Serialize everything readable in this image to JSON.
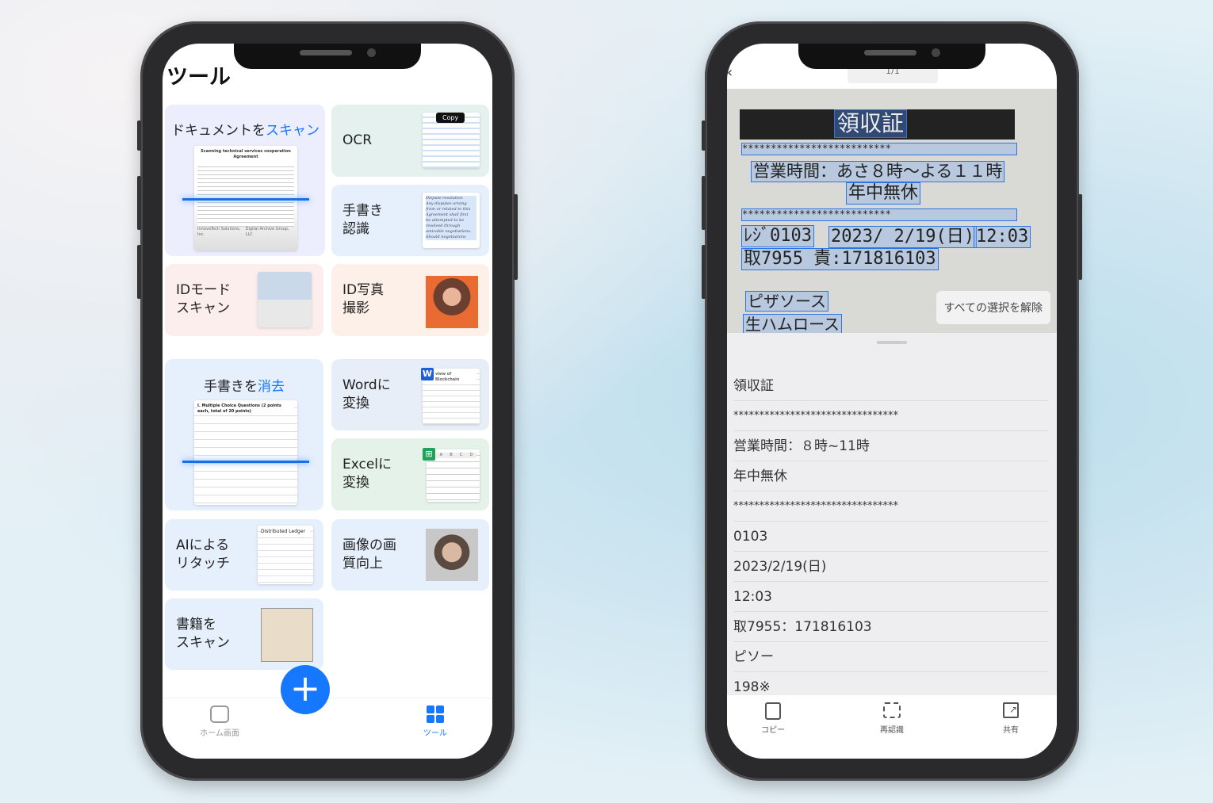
{
  "left_phone": {
    "title": "ツール",
    "cards": [
      {
        "label_main": "ドキュメントを",
        "label_accent": "スキャン",
        "thumb_title": "Scanning technical services cooperation Agreement",
        "thumb_footer_left": "InnovaTech Solutions, Inc.",
        "thumb_footer_right": "Digital Archive Group, LLC"
      },
      {
        "label": "OCR",
        "tooltip": "Copy"
      },
      {
        "label": "手書き\n認識",
        "thumb_lines": [
          "Dispute resolution",
          "Any disputes arising",
          "from or related to this",
          "Agreement shall first",
          "be attempted to be",
          "resolved through",
          "amicable negotiations.",
          "Should negotiations"
        ]
      },
      {
        "label": "IDモード\nスキャン"
      },
      {
        "label": "ID写真\n撮影"
      },
      {
        "label_main": "手書きを",
        "label_accent": "消去",
        "thumb_title": "I. Multiple Choice Questions (2 points each, total of 20 points)"
      },
      {
        "label": "Wordに\n変換",
        "thumb_title": "view of Blockchain",
        "icon_letter": "W"
      },
      {
        "label": "Excelに\n変換",
        "col_headers": [
          "A",
          "B",
          "C",
          "D"
        ]
      },
      {
        "label": "AIによる\nリタッチ",
        "thumb_title": "Distributed Ledger"
      },
      {
        "label": "画像の画\n質向上"
      },
      {
        "label": "書籍を\nスキャン"
      }
    ],
    "nav": {
      "home": "ホーム画面",
      "tools": "ツール",
      "add_icon": "plus-icon"
    },
    "accent": "#1677ff"
  },
  "right_phone": {
    "page_indicator": "1/1",
    "receipt": {
      "header": "領収証",
      "stars": "**************************",
      "hours": "営業時間：あさ８時～よる１１時",
      "holiday": "年中無休",
      "register": "ﾚｼﾞ0103",
      "date": "2023/ 2/19(日)",
      "time": "12:03",
      "transaction": "取7955 責:171816103",
      "item1": "ピザソース",
      "item2": "生ハムロース",
      "price": "198※"
    },
    "deselect_all": "すべての選択を解除",
    "results": [
      "領収証",
      "********************************",
      "営業時間：８時~11時",
      "年中無休",
      "********************************",
      "0103",
      "2023/2/19(日)",
      "12:03",
      "取7955：171816103",
      "ピソー",
      "198※"
    ],
    "toolbar": {
      "copy": "コピー",
      "rescan": "再認識",
      "share": "共有"
    }
  }
}
